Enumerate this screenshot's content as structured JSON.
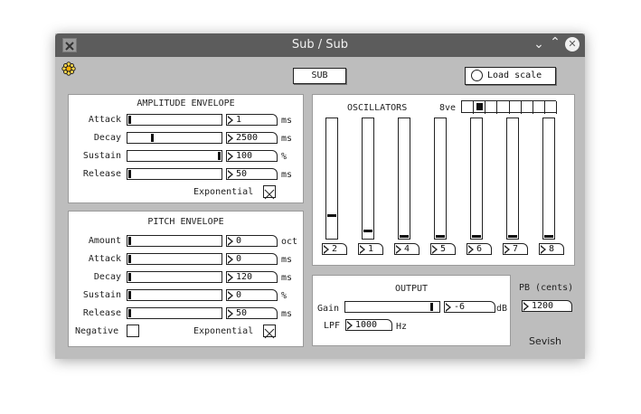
{
  "window": {
    "title": "Sub / Sub"
  },
  "toolbar": {
    "sub_label": "SUB",
    "load_scale_label": "Load scale"
  },
  "amplitude": {
    "title": "AMPLITUDE ENVELOPE",
    "rows": [
      {
        "label": "Attack",
        "value": "1",
        "unit": "ms",
        "level": 0.0
      },
      {
        "label": "Decay",
        "value": "2500",
        "unit": "ms",
        "level": 0.25
      },
      {
        "label": "Sustain",
        "value": "100",
        "unit": "%",
        "level": 1.0
      },
      {
        "label": "Release",
        "value": "50",
        "unit": "ms",
        "level": 0.0
      }
    ],
    "exponential_label": "Exponential",
    "exponential_checked": true
  },
  "pitch": {
    "title": "PITCH ENVELOPE",
    "rows": [
      {
        "label": "Amount",
        "value": "0",
        "unit": "oct",
        "level": 0.0
      },
      {
        "label": "Attack",
        "value": "0",
        "unit": "ms",
        "level": 0.0
      },
      {
        "label": "Decay",
        "value": "120",
        "unit": "ms",
        "level": 0.0
      },
      {
        "label": "Sustain",
        "value": "0",
        "unit": "%",
        "level": 0.0
      },
      {
        "label": "Release",
        "value": "50",
        "unit": "ms",
        "level": 0.0
      }
    ],
    "negative_label": "Negative",
    "negative_checked": false,
    "exponential_label": "Exponential",
    "exponential_checked": true
  },
  "oscillators": {
    "title": "OSCILLATORS",
    "octave_label": "8ve",
    "octave_selected": 2,
    "octave_cells": 8,
    "sliders": [
      {
        "value": "2",
        "level": 0.18
      },
      {
        "value": "1",
        "level": 0.05
      },
      {
        "value": "4",
        "level": 0.0
      },
      {
        "value": "5",
        "level": 0.0
      },
      {
        "value": "6",
        "level": 0.0
      },
      {
        "value": "7",
        "level": 0.0
      },
      {
        "value": "8",
        "level": 0.0
      }
    ]
  },
  "output": {
    "title": "OUTPUT",
    "gain_label": "Gain",
    "gain_value": "-6",
    "gain_unit": "dB",
    "gain_level": 0.94,
    "lpf_label": "LPF",
    "lpf_value": "1000",
    "lpf_unit": "Hz"
  },
  "pitchbend": {
    "label": "PB (cents)",
    "value": "1200"
  },
  "brand": {
    "text": "Sevish"
  }
}
